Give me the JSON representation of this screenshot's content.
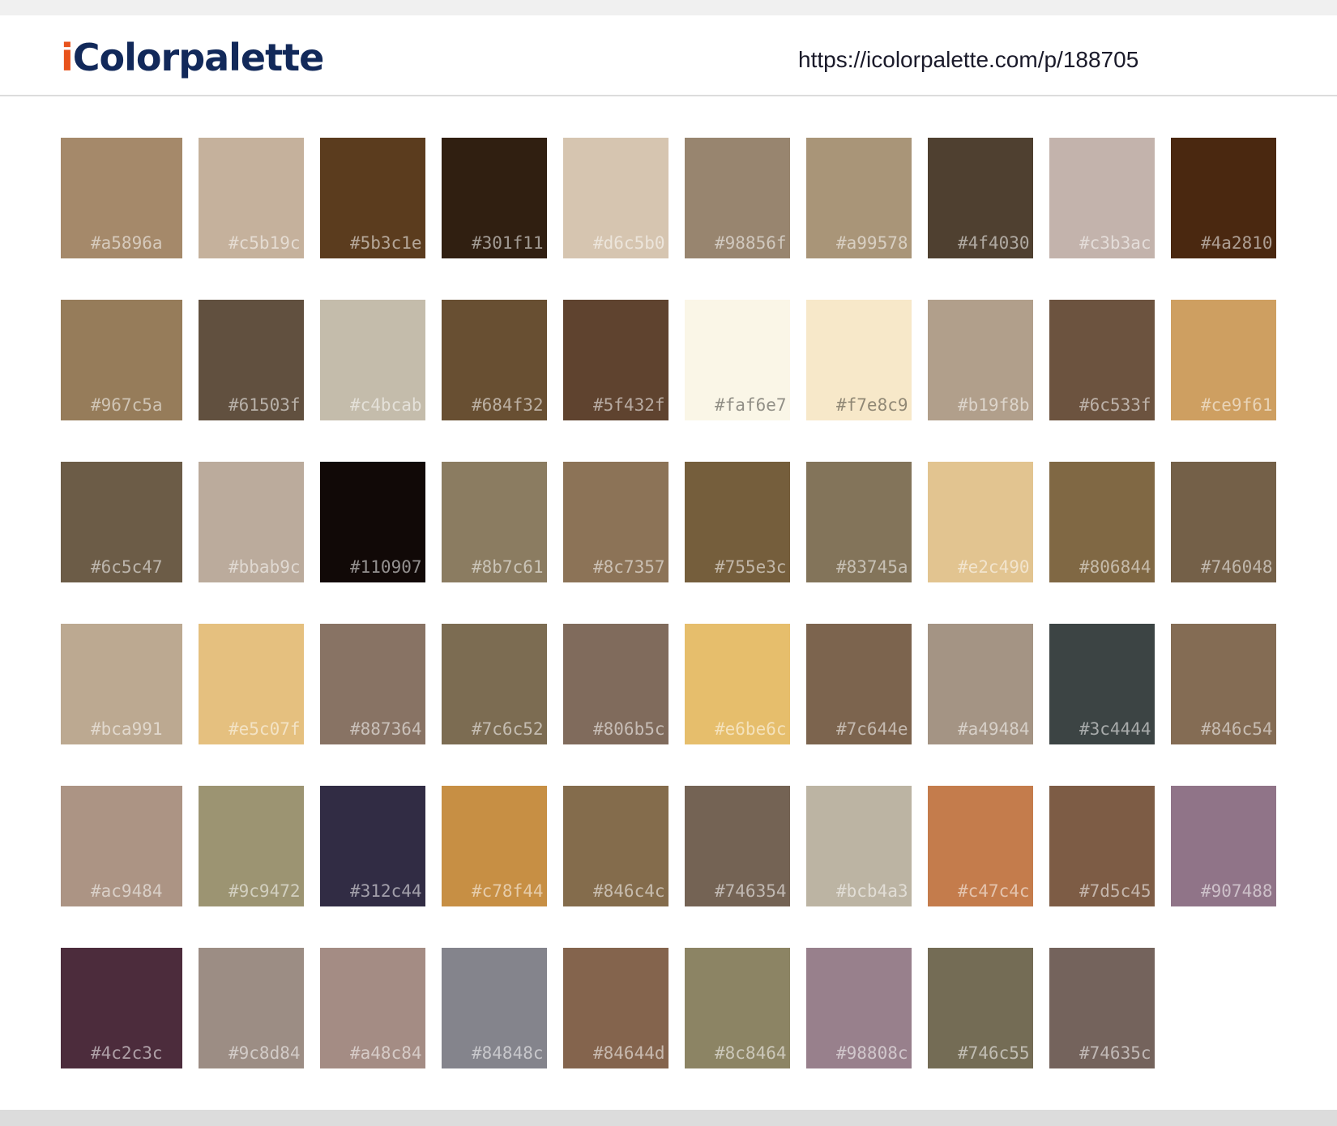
{
  "header": {
    "logo_i": "i",
    "logo_rest": "Colorpalette",
    "url": "https://icolorpalette.com/p/188705"
  },
  "swatches": [
    "#a5896a",
    "#c5b19c",
    "#5b3c1e",
    "#301f11",
    "#d6c5b0",
    "#98856f",
    "#a99578",
    "#4f4030",
    "#c3b3ac",
    "#4a2810",
    "#967c5a",
    "#61503f",
    "#c4bcab",
    "#684f32",
    "#5f432f",
    "#faf6e7",
    "#f7e8c9",
    "#b19f8b",
    "#6c533f",
    "#ce9f61",
    "#6c5c47",
    "#bbab9c",
    "#110907",
    "#8b7c61",
    "#8c7357",
    "#755e3c",
    "#83745a",
    "#e2c490",
    "#806844",
    "#746048",
    "#bca991",
    "#e5c07f",
    "#887364",
    "#7c6c52",
    "#806b5c",
    "#e6be6c",
    "#7c644e",
    "#a49484",
    "#3c4444",
    "#846c54",
    "#ac9484",
    "#9c9472",
    "#312c44",
    "#c78f44",
    "#846c4c",
    "#746354",
    "#bcb4a3",
    "#c47c4c",
    "#7d5c45",
    "#907488",
    "#4c2c3c",
    "#9c8d84",
    "#a48c84",
    "#84848c",
    "#84644d",
    "#8c8464",
    "#98808c",
    "#746c55",
    "#74635c"
  ]
}
